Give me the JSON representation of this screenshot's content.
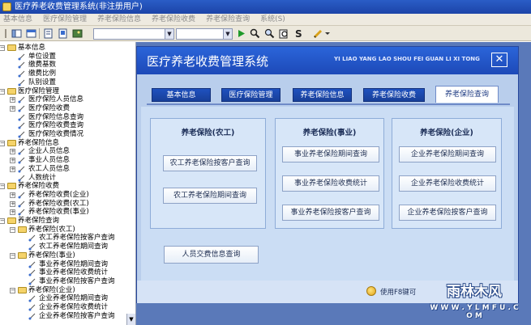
{
  "window": {
    "title": "医疗养老收费管理系统(非注册用户)"
  },
  "menu": [
    "基本信息",
    "医疗保险管理",
    "养老保险信息",
    "养老保险收费",
    "养老保险查询",
    "系统(S)"
  ],
  "tree": [
    {
      "level": 0,
      "exp": "-",
      "kind": "folder",
      "label": "基本信息"
    },
    {
      "level": 1,
      "kind": "leaf",
      "label": "单位设置"
    },
    {
      "level": 1,
      "kind": "leaf",
      "label": "缴费基数"
    },
    {
      "level": 1,
      "kind": "leaf",
      "label": "缴费比例"
    },
    {
      "level": 1,
      "kind": "leaf",
      "label": "队别设置"
    },
    {
      "level": 0,
      "exp": "-",
      "kind": "folder",
      "label": "医疗保险管理"
    },
    {
      "level": 1,
      "exp": "+",
      "kind": "leaf",
      "label": "医疗保险人员信息"
    },
    {
      "level": 1,
      "exp": "+",
      "kind": "leaf",
      "label": "医疗保险收费"
    },
    {
      "level": 1,
      "kind": "leaf",
      "label": "医疗保险信息查询"
    },
    {
      "level": 1,
      "kind": "leaf",
      "label": "医疗保险收费查询"
    },
    {
      "level": 1,
      "kind": "leaf",
      "label": "医疗保险收费情况"
    },
    {
      "level": 0,
      "exp": "-",
      "kind": "folder",
      "label": "养老保险信息"
    },
    {
      "level": 1,
      "exp": "+",
      "kind": "leaf",
      "label": "企业人员信息"
    },
    {
      "level": 1,
      "exp": "+",
      "kind": "leaf",
      "label": "事业人员信息"
    },
    {
      "level": 1,
      "exp": "+",
      "kind": "leaf",
      "label": "农工人员信息"
    },
    {
      "level": 1,
      "kind": "leaf",
      "label": "人数统计"
    },
    {
      "level": 0,
      "exp": "-",
      "kind": "folder",
      "label": "养老保险收费"
    },
    {
      "level": 1,
      "exp": "+",
      "kind": "leaf",
      "label": "养老保险收费(企业)"
    },
    {
      "level": 1,
      "exp": "+",
      "kind": "leaf",
      "label": "养老保险收费(农工)"
    },
    {
      "level": 1,
      "exp": "+",
      "kind": "leaf",
      "label": "养老保险收费(事业)"
    },
    {
      "level": 0,
      "exp": "-",
      "kind": "folder",
      "label": "养老保险查询"
    },
    {
      "level": 1,
      "exp": "-",
      "kind": "folder",
      "label": "养老保险(农工)"
    },
    {
      "level": 2,
      "kind": "leaf",
      "label": "农工养老保险按客户查询"
    },
    {
      "level": 2,
      "kind": "leaf",
      "label": "农工养老保险期间查询"
    },
    {
      "level": 1,
      "exp": "-",
      "kind": "folder",
      "label": "养老保险(事业)"
    },
    {
      "level": 2,
      "kind": "leaf",
      "label": "事业养老保险期间查询"
    },
    {
      "level": 2,
      "kind": "leaf",
      "label": "事业养老保险收费统计"
    },
    {
      "level": 2,
      "kind": "leaf",
      "label": "事业养老保险按客户查询"
    },
    {
      "level": 1,
      "exp": "-",
      "kind": "folder",
      "label": "养老保险(企业)"
    },
    {
      "level": 2,
      "kind": "leaf",
      "label": "企业养老保险期间查询"
    },
    {
      "level": 2,
      "kind": "leaf",
      "label": "企业养老保险收费统计"
    },
    {
      "level": 2,
      "kind": "leaf",
      "label": "企业养老保险按客户查询"
    }
  ],
  "child": {
    "title": "医疗养老收费管理系统",
    "pinyin": "YI LIAO YANG LAO SHOU FEI GUAN LI XI TONG",
    "close": "✕",
    "tabs": [
      "基本信息",
      "医疗保险管理",
      "养老保险信息",
      "养老保险收费",
      "养老保险查询"
    ],
    "active_tab": 4,
    "groups": [
      {
        "title": "养老保险(农工)",
        "buttons": [
          "农工养老保险按客户查询",
          "农工养老保险期间查询"
        ]
      },
      {
        "title": "养老保险(事业)",
        "buttons": [
          "事业养老保险期间查询",
          "事业养老保险收费统计",
          "事业养老保险按客户查询"
        ]
      },
      {
        "title": "养老保险(企业)",
        "buttons": [
          "企业养老保险期间查询",
          "企业养老保险收费统计",
          "企业养老保险按客户查询"
        ]
      }
    ],
    "extra_button": "人员交费信息查询",
    "status": "使用F8键可"
  },
  "watermark": {
    "title": "雨林木风",
    "url": "W W W . Y L M F U . C O M"
  },
  "icons": {
    "folder": "folder-icon",
    "leaf": "document-icon",
    "search": "search-icon",
    "run": "play-icon",
    "edit": "pencil-icon"
  },
  "colors": {
    "titlebar": "#1c44a8",
    "workspace": "#5a79b9",
    "panel": "#b9ceec",
    "accent": "#1f51bf"
  }
}
